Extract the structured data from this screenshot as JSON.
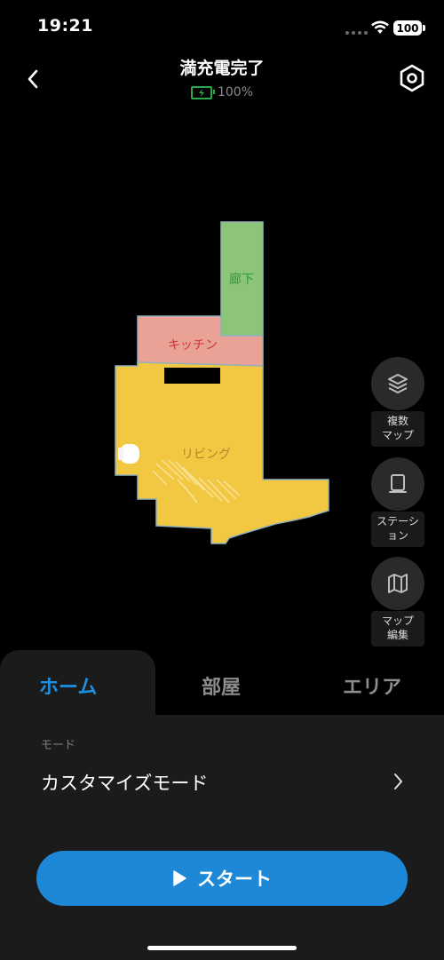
{
  "status_bar": {
    "time": "19:21",
    "battery_level": "100"
  },
  "header": {
    "title": "満充電完了",
    "battery_percent": "100%"
  },
  "map": {
    "rooms": [
      {
        "name": "廊下",
        "color": "#8cc47a",
        "label_color": "#2f9a3c"
      },
      {
        "name": "キッチン",
        "color": "#eba296",
        "label_color": "#c8353b"
      },
      {
        "name": "リビング",
        "color": "#f2c842",
        "label_color": "#b7862a"
      }
    ]
  },
  "side_buttons": [
    {
      "icon": "layers-icon",
      "label_line1": "複数",
      "label_line2": "マップ"
    },
    {
      "icon": "station-icon",
      "label_line1": "ステーシ",
      "label_line2": "ョン"
    },
    {
      "icon": "map-icon",
      "label_line1": "マップ",
      "label_line2": "編集"
    }
  ],
  "tabs": {
    "home": "ホーム",
    "room": "部屋",
    "area": "エリア",
    "active": "home"
  },
  "mode": {
    "caption": "モード",
    "value": "カスタマイズモード"
  },
  "start_button": {
    "label": "スタート"
  },
  "colors": {
    "accent": "#1e88d8",
    "active_tab": "#1e8fe0",
    "sheet_bg": "#1b1b1b"
  }
}
